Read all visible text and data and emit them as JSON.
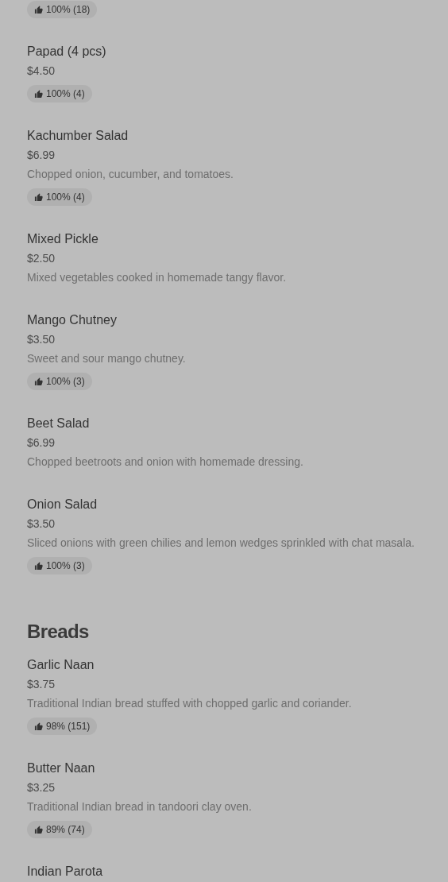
{
  "sections": [
    {
      "items": [
        {
          "rating": "100% (18)"
        },
        {
          "name": "Papad (4 pcs)",
          "price": "$4.50",
          "rating": "100% (4)"
        },
        {
          "name": "Kachumber Salad",
          "price": "$6.99",
          "description": "Chopped onion, cucumber, and tomatoes.",
          "rating": "100% (4)"
        },
        {
          "name": "Mixed Pickle",
          "price": "$2.50",
          "description": "Mixed vegetables cooked in homemade tangy flavor."
        },
        {
          "name": "Mango Chutney",
          "price": "$3.50",
          "description": "Sweet and sour mango chutney.",
          "rating": "100% (3)"
        },
        {
          "name": "Beet Salad",
          "price": "$6.99",
          "description": "Chopped beetroots and onion with homemade dressing."
        },
        {
          "name": "Onion Salad",
          "price": "$3.50",
          "description": "Sliced onions with green chilies and lemon wedges sprinkled with chat masala.",
          "rating": "100% (3)"
        }
      ]
    },
    {
      "heading": "Breads",
      "items": [
        {
          "name": "Garlic Naan",
          "price": "$3.75",
          "description": "Traditional Indian bread stuffed with chopped garlic and coriander.",
          "rating": "98% (151)"
        },
        {
          "name": "Butter Naan",
          "price": "$3.25",
          "description": "Traditional Indian bread in tandoori clay oven.",
          "rating": "89% (74)"
        },
        {
          "name": "Indian Parota"
        }
      ]
    }
  ]
}
